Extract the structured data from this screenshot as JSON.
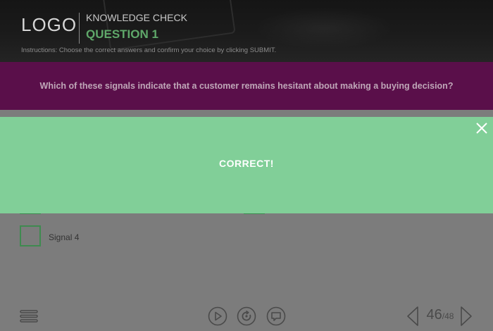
{
  "header": {
    "logo": "LOGO",
    "section_title": "KNOWLEDGE CHECK",
    "question_number": "QUESTION 1",
    "instructions": "Instructions: Choose the correct answers and confirm your choice by clicking SUBMIT."
  },
  "question": {
    "text": "Which of these signals indicate that a customer remains hesitant about making a buying decision?"
  },
  "options": [
    {
      "label": "Signal 4"
    }
  ],
  "feedback": {
    "message": "CORRECT!",
    "color": "#81cf98"
  },
  "footer": {
    "current_page": "46",
    "total_pages": "/48"
  },
  "icons": {
    "menu": "menu-icon",
    "play": "play-icon",
    "replay": "replay-icon",
    "comment": "comment-icon",
    "prev": "chevron-left-icon",
    "next": "chevron-right-icon",
    "close": "close-icon"
  },
  "colors": {
    "accent_green": "#5fa86a",
    "question_band": "#5a0f4a",
    "header_bg": "#1b1b1b"
  }
}
